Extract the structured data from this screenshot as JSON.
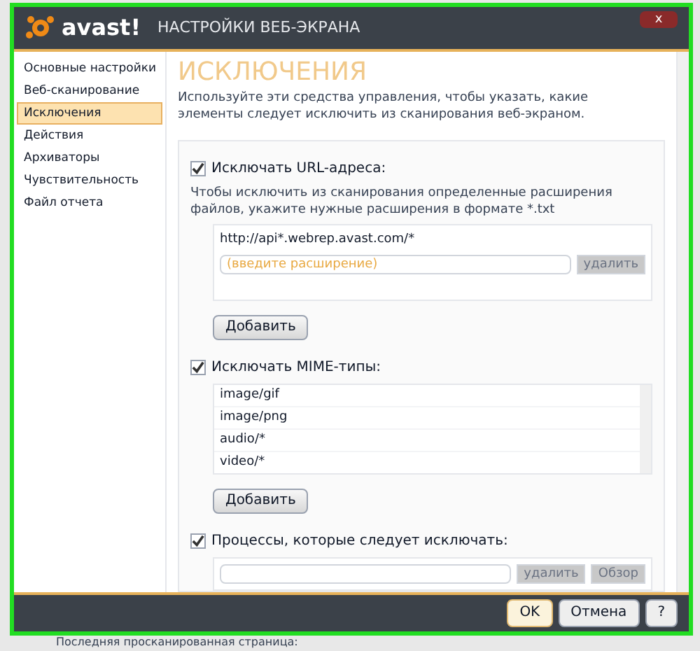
{
  "window": {
    "logo": "avast!",
    "title": "НАСТРОЙКИ ВЕБ-ЭКРАНА",
    "close": "x"
  },
  "sidebar": {
    "items": [
      {
        "label": "Основные настройки",
        "selected": false
      },
      {
        "label": "Веб-сканирование",
        "selected": false
      },
      {
        "label": "Исключения",
        "selected": true
      },
      {
        "label": "Действия",
        "selected": false
      },
      {
        "label": "Архиваторы",
        "selected": false
      },
      {
        "label": "Чувствительность",
        "selected": false
      },
      {
        "label": "Файл отчета",
        "selected": false
      }
    ]
  },
  "page": {
    "heading": "ИСКЛЮЧЕНИЯ",
    "description": "Используйте эти средства управления, чтобы указать, какие элементы следует исключить из сканирования веб-экраном."
  },
  "url_section": {
    "label": "Исключать URL-адреса:",
    "checked": true,
    "hint": "Чтобы исключить из сканирования определенные расширения файлов, укажите нужные расширения в формате *.txt",
    "entries": [
      "http://api*.webrep.avast.com/*"
    ],
    "input_placeholder": "(введите расширение)",
    "delete_button": "удалить",
    "add_button": "Добавить"
  },
  "mime_section": {
    "label": "Исключать MIME-типы:",
    "checked": true,
    "entries": [
      "image/gif",
      "image/png",
      "audio/*",
      "video/*"
    ],
    "add_button": "Добавить"
  },
  "process_section": {
    "label": "Процессы, которые следует исключать:",
    "checked": true,
    "delete_button": "удалить",
    "browse_button": "Обзор"
  },
  "footer": {
    "buttons": [
      {
        "label": "OK",
        "kind": "primary"
      },
      {
        "label": "Отмена",
        "kind": "normal"
      },
      {
        "label": "?",
        "kind": "normal"
      }
    ]
  },
  "background_text": "Последняя просканированная страница:"
}
